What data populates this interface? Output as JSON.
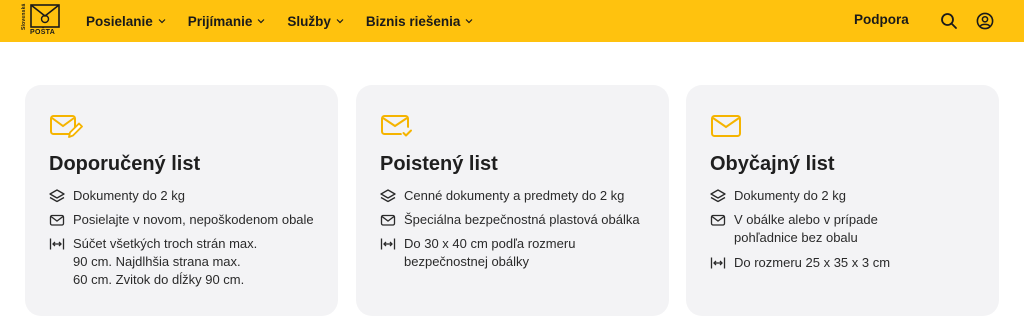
{
  "header": {
    "logo_vertical_text": "Slovenská",
    "logo_text": "POŠTA",
    "nav": [
      {
        "label": "Posielanie"
      },
      {
        "label": "Prijímanie"
      },
      {
        "label": "Služby"
      },
      {
        "label": "Biznis riešenia"
      }
    ],
    "support_label": "Podpora",
    "search_icon": "search-icon",
    "account_icon": "user-icon"
  },
  "colors": {
    "brand_yellow": "#FFC20E",
    "card_bg": "#F3F3F5"
  },
  "cards": [
    {
      "title": "Doporučený list",
      "icon": "envelope-pencil-icon",
      "features": [
        {
          "icon": "layers-icon",
          "text": "Dokumenty do 2 kg"
        },
        {
          "icon": "envelope-icon",
          "text": "Posielajte v novom, nepoškodenom obale"
        },
        {
          "icon": "dimensions-icon",
          "lines": [
            "Súčet všetkých troch strán max.",
            "90 cm. Najdlhšia strana max.",
            "60 cm. Zvitok do dĺžky 90 cm."
          ]
        }
      ]
    },
    {
      "title": "Poistený list",
      "icon": "envelope-check-icon",
      "features": [
        {
          "icon": "layers-icon",
          "text": "Cenné dokumenty a predmety do 2 kg"
        },
        {
          "icon": "envelope-icon",
          "text": "Špeciálna bezpečnostná plastová obálka"
        },
        {
          "icon": "dimensions-icon",
          "lines": [
            "Do 30 x 40 cm podľa rozmeru",
            "bezpečnostnej obálky"
          ]
        }
      ]
    },
    {
      "title": "Obyčajný list",
      "icon": "envelope-icon",
      "features": [
        {
          "icon": "layers-icon",
          "text": "Dokumenty do 2 kg"
        },
        {
          "icon": "envelope-icon",
          "lines": [
            "V obálke alebo v prípade",
            "pohľadnice bez obalu"
          ]
        },
        {
          "icon": "dimensions-icon",
          "text": "Do rozmeru 25 x 35 x 3 cm"
        }
      ]
    }
  ]
}
